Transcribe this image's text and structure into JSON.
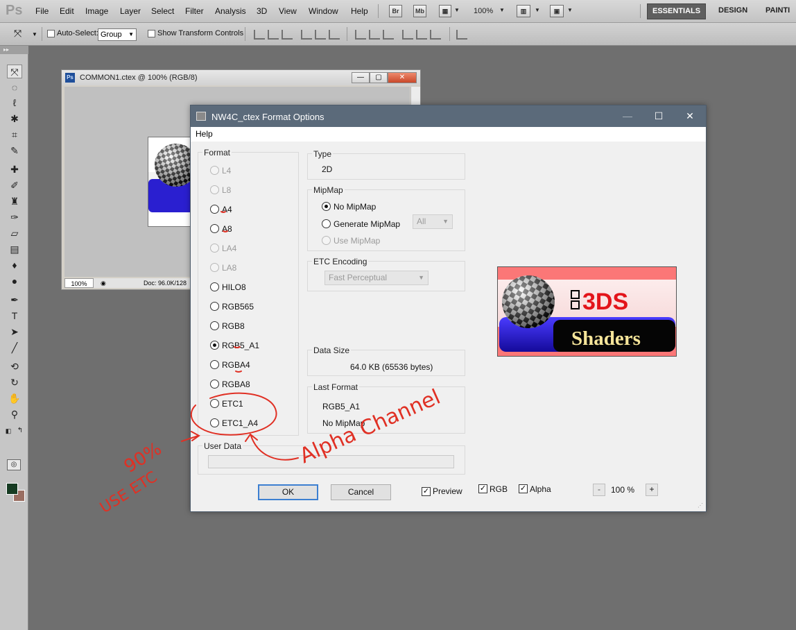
{
  "app": {
    "menu": [
      "File",
      "Edit",
      "Image",
      "Layer",
      "Select",
      "Filter",
      "Analysis",
      "3D",
      "View",
      "Window",
      "Help"
    ],
    "bridge_label": "Br",
    "minibridge_label": "Mb",
    "zoom_label": "100%",
    "workspaces": {
      "essentials": "ESSENTIALS",
      "design": "DESIGN",
      "painting": "PAINTI"
    }
  },
  "options_bar": {
    "auto_select_label": "Auto-Select:",
    "auto_select_value": "Group",
    "transform_controls_label": "Show Transform Controls"
  },
  "tools_panel": {
    "grip": "▸▸",
    "tools": [
      "move-tool-icon",
      "marquee-tool-icon",
      "lasso-tool-icon",
      "magic-wand-icon",
      "crop-tool-icon",
      "eyedropper-icon",
      "healing-brush-icon",
      "brush-tool-icon",
      "clone-stamp-icon",
      "history-brush-icon",
      "eraser-tool-icon",
      "gradient-tool-icon",
      "blur-tool-icon",
      "dodge-tool-icon",
      "pen-tool-icon",
      "type-tool-icon",
      "path-selection-icon",
      "line-tool-icon",
      "3d-rotate-icon",
      "3d-orbit-icon",
      "hand-tool-icon",
      "zoom-tool-icon"
    ],
    "fg_color": "#163b22",
    "bg_color": "#9a6e62"
  },
  "document": {
    "title": "COMMON1.ctex @ 100% (RGB/8)",
    "ps_badge": "Ps",
    "zoom": "100%",
    "info": "Doc: 96.0K/128"
  },
  "dialog": {
    "title": "NW4C_ctex Format Options",
    "menu_help": "Help",
    "format": {
      "title": "Format",
      "options": [
        {
          "label": "L4",
          "enabled": false,
          "checked": false
        },
        {
          "label": "L8",
          "enabled": false,
          "checked": false
        },
        {
          "label": "A4",
          "enabled": true,
          "checked": false
        },
        {
          "label": "A8",
          "enabled": true,
          "checked": false
        },
        {
          "label": "LA4",
          "enabled": false,
          "checked": false
        },
        {
          "label": "LA8",
          "enabled": false,
          "checked": false
        },
        {
          "label": "HILO8",
          "enabled": true,
          "checked": false
        },
        {
          "label": "RGB565",
          "enabled": true,
          "checked": false
        },
        {
          "label": "RGB8",
          "enabled": true,
          "checked": false
        },
        {
          "label": "RGB5_A1",
          "enabled": true,
          "checked": true
        },
        {
          "label": "RGBA4",
          "enabled": true,
          "checked": false
        },
        {
          "label": "RGBA8",
          "enabled": true,
          "checked": false
        },
        {
          "label": "ETC1",
          "enabled": true,
          "checked": false
        },
        {
          "label": "ETC1_A4",
          "enabled": true,
          "checked": false
        }
      ]
    },
    "type": {
      "title": "Type",
      "value": "2D"
    },
    "mipmap": {
      "title": "MipMap",
      "no_mipmap": "No MipMap",
      "generate_mipmap": "Generate MipMap",
      "use_mipmap": "Use MipMap",
      "level_value": "All"
    },
    "etc": {
      "title": "ETC Encoding",
      "value": "Fast Perceptual"
    },
    "data_size": {
      "title": "Data Size",
      "value": "64.0 KB (65536 bytes)"
    },
    "last_format": {
      "title": "Last Format",
      "format": "RGB5_A1",
      "mipmap": "No MipMap"
    },
    "user_data": {
      "title": "User Data",
      "value": ""
    },
    "buttons": {
      "ok": "OK",
      "cancel": "Cancel"
    },
    "preview": {
      "preview_label": "Preview",
      "rgb_label": "RGB",
      "alpha_label": "Alpha",
      "zoom": "100 %",
      "zoom_minus": "-",
      "zoom_plus": "+"
    },
    "logo": {
      "title": "3DS",
      "subtitle": "Shaders"
    }
  },
  "annotation": {
    "color": "#e03024",
    "percent": "90%",
    "use_etc": "USE ETC",
    "alpha_channel": "Alpha Channel"
  }
}
